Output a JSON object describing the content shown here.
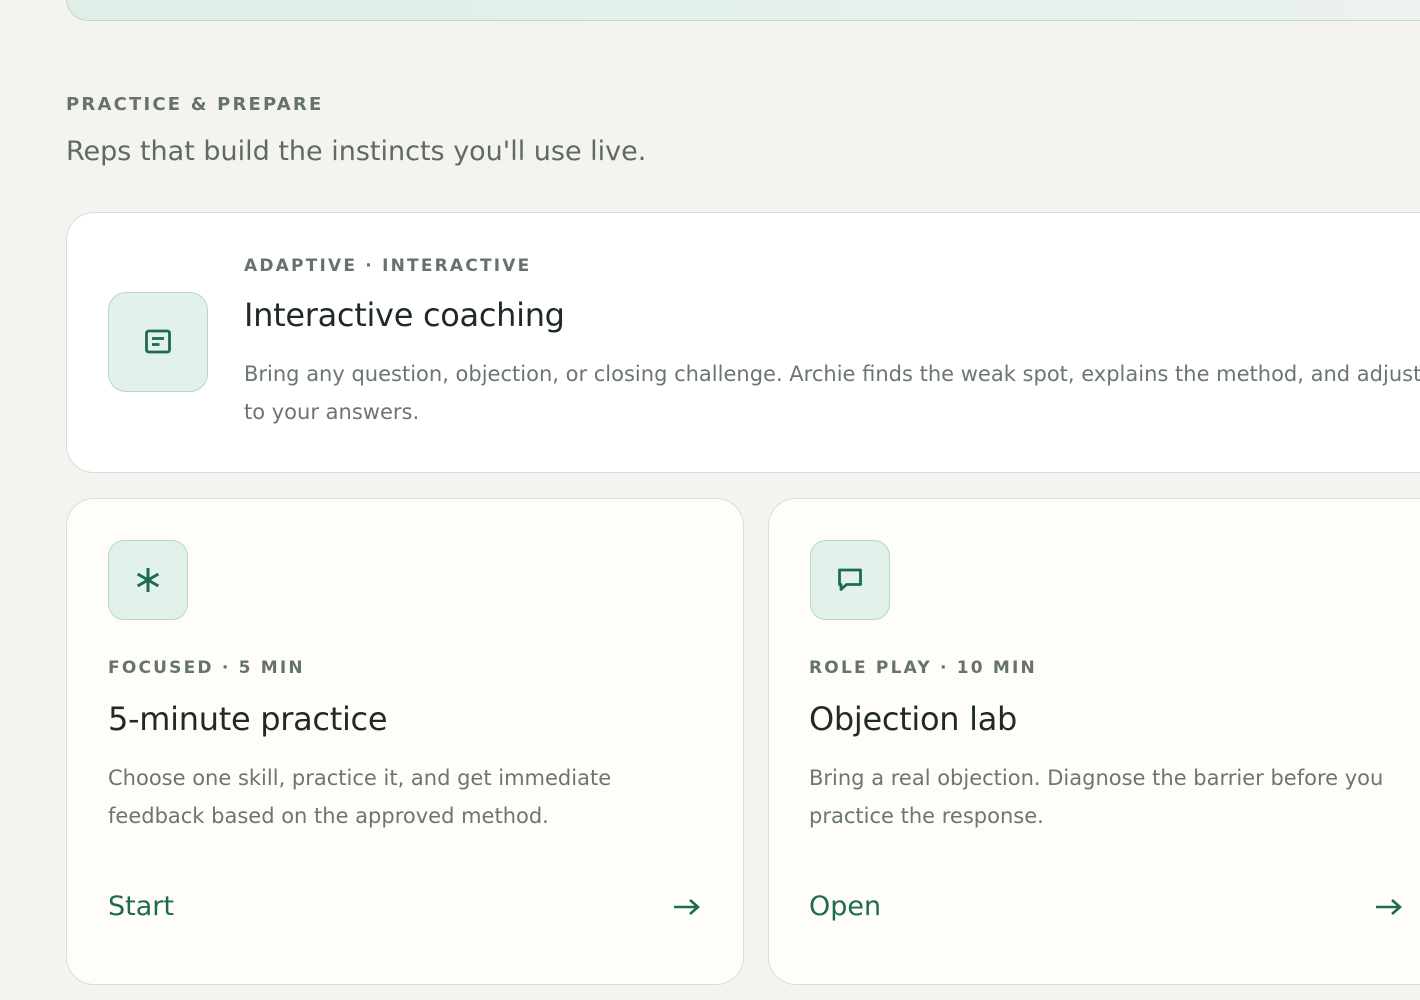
{
  "section": {
    "eyebrow": "PRACTICE & PREPARE",
    "subtitle": "Reps that build the instincts you'll use live."
  },
  "cards": [
    {
      "icon": "document-icon",
      "eyebrow": "ADAPTIVE · INTERACTIVE",
      "title": "Interactive coaching",
      "description": "Bring any question, objection, or closing challenge. Archie finds the weak spot, explains the method, and adjusts to your answers."
    },
    {
      "icon": "asterisk-icon",
      "eyebrow": "FOCUSED · 5 MIN",
      "title": "5-minute practice",
      "description": "Choose one skill, practice it, and get immediate feedback based on the approved method.",
      "action": "Start"
    },
    {
      "icon": "chat-bubble-icon",
      "eyebrow": "ROLE PLAY · 10 MIN",
      "title": "Objection lab",
      "description": "Bring a real objection. Diagnose the barrier before you practice the response.",
      "action": "Open"
    }
  ],
  "colors": {
    "background": "#f4f3ef",
    "accent": "#1d6b55",
    "icon_tile": "#e2f2ea",
    "banner": "#dfeee7"
  }
}
